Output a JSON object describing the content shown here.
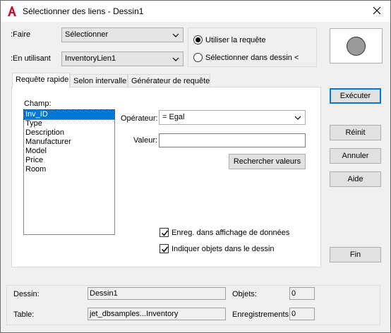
{
  "window": {
    "title": "Sélectionner des liens - Dessin1"
  },
  "top": {
    "faire_label": ":Faire",
    "faire_value": "Sélectionner",
    "en_utilisant_label": ":En utilisant",
    "en_utilisant_value": "InventoryLien1",
    "radio_query": "Utiliser la requête",
    "radio_query_selected": true,
    "radio_drawing": "Sélectionner dans dessin <",
    "radio_drawing_selected": false
  },
  "tabs": [
    {
      "label": "Requête rapide",
      "active": true
    },
    {
      "label": "Selon intervalle",
      "active": false
    },
    {
      "label": "Générateur de requête",
      "active": false
    }
  ],
  "quick_query": {
    "champ_label": "Champ:",
    "fields": [
      "Inv_ID",
      "Type",
      "Description",
      "Manufacturer",
      "Model",
      "Price",
      "Room"
    ],
    "selected_field": "Inv_ID",
    "operateur_label": "Opérateur:",
    "operateur_value": "=   Egal",
    "valeur_label": "Valeur:",
    "valeur_value": "",
    "search_button": "Rechercher valeurs",
    "check_datagrid": "Enreg. dans affichage de données",
    "check_datagrid_checked": true,
    "check_objects": "Indiquer objets dans le dessin",
    "check_objects_checked": true
  },
  "side_buttons": {
    "execute": "Exécuter",
    "reset": "Réinit",
    "cancel": "Annuler",
    "help": "Aide",
    "end": "Fin"
  },
  "status": {
    "dessin_label": "Dessin:",
    "dessin_value": "Dessin1",
    "table_label": "Table:",
    "table_value": "jet_dbsamples...Inventory",
    "objets_label": "Objets:",
    "objets_value": "0",
    "enreg_label": "Enregistrements:",
    "enreg_value": "0"
  },
  "colors": {
    "accent": "#0078d7",
    "app_icon": "#c8102e",
    "preview_fill": "#9a9a9a"
  }
}
